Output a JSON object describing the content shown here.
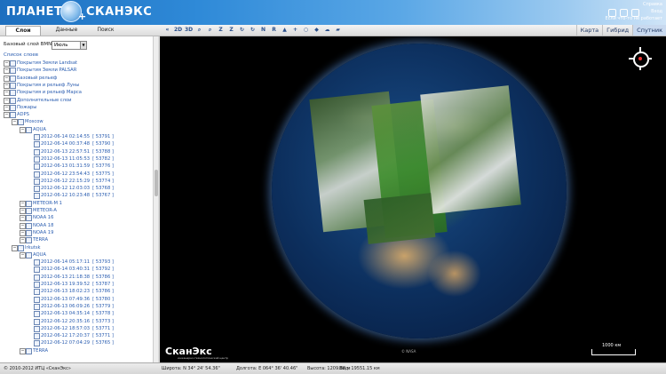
{
  "header": {
    "logo_left": "ПЛАНЕТА",
    "logo_right": "СКАНЭКС",
    "link1": "Справка",
    "link2": "Вход",
    "link3": "Если что-то не работает"
  },
  "tabs": {
    "layers": "Слои",
    "data": "Данные",
    "search": "Поиск"
  },
  "toolbar": {
    "tools": [
      "«",
      "2D",
      "3D",
      "⌕",
      "⌕",
      "Z",
      "Z",
      "↻",
      "↻",
      "N",
      "R",
      "▲",
      "+",
      "○",
      "◆",
      "☁",
      "▰"
    ],
    "map_tabs": [
      "Карта",
      "Гибрид",
      "Спутник"
    ],
    "active_map_tab": "Спутник"
  },
  "sidebar": {
    "base_label": "Базовый слой BMNG:",
    "base_value": "Июль",
    "list_header": "Список слоев",
    "rows": [
      {
        "d": 0,
        "t": "Покрытия Земли Landsat"
      },
      {
        "d": 0,
        "t": "Покрытия Земли PALSAR"
      },
      {
        "d": 0,
        "t": "Базовый рельеф"
      },
      {
        "d": 0,
        "t": "Покрытия и рельеф Луны"
      },
      {
        "d": 0,
        "t": "Покрытия и рельеф Марса"
      },
      {
        "d": 0,
        "t": "Дополнительные слои"
      },
      {
        "d": 0,
        "t": "Пожары"
      },
      {
        "d": 0,
        "t": "ADPS"
      },
      {
        "d": 1,
        "t": "Moscow"
      },
      {
        "d": 2,
        "t": "AQUA"
      },
      {
        "d": 3,
        "t": "2012-06-14 02:14:55",
        "id": "[ 53791 ]"
      },
      {
        "d": 3,
        "t": "2012-06-14 00:37:48",
        "id": "[ 53790 ]"
      },
      {
        "d": 3,
        "t": "2012-06-13 22:57:51",
        "id": "[ 53788 ]"
      },
      {
        "d": 3,
        "t": "2012-06-13 11:05:53",
        "id": "[ 53782 ]"
      },
      {
        "d": 3,
        "t": "2012-06-13 01:31:59",
        "id": "[ 53776 ]"
      },
      {
        "d": 3,
        "t": "2012-06-12 23:54:43",
        "id": "[ 53775 ]"
      },
      {
        "d": 3,
        "t": "2012-06-12 22:15:29",
        "id": "[ 53774 ]"
      },
      {
        "d": 3,
        "t": "2012-06-12 12:03:03",
        "id": "[ 53768 ]"
      },
      {
        "d": 3,
        "t": "2012-06-12 10:23:48",
        "id": "[ 53767 ]"
      },
      {
        "d": 2,
        "t": "METEOR-M 1"
      },
      {
        "d": 2,
        "t": "METEOR-A"
      },
      {
        "d": 2,
        "t": "NOAA 16"
      },
      {
        "d": 2,
        "t": "NOAA 18"
      },
      {
        "d": 2,
        "t": "NOAA 19"
      },
      {
        "d": 2,
        "t": "TERRA"
      },
      {
        "d": 1,
        "t": "Irkutsk"
      },
      {
        "d": 2,
        "t": "AQUA"
      },
      {
        "d": 3,
        "t": "2012-06-14 05:17:11",
        "id": "[ 53793 ]"
      },
      {
        "d": 3,
        "t": "2012-06-14 03:40:31",
        "id": "[ 53792 ]"
      },
      {
        "d": 3,
        "t": "2012-06-13 21:18:38",
        "id": "[ 53786 ]"
      },
      {
        "d": 3,
        "t": "2012-06-13 19:39:52",
        "id": "[ 53787 ]"
      },
      {
        "d": 3,
        "t": "2012-06-13 18:02:23",
        "id": "[ 53786 ]"
      },
      {
        "d": 3,
        "t": "2012-06-13 07:49:36",
        "id": "[ 53780 ]"
      },
      {
        "d": 3,
        "t": "2012-06-13 06:09:26",
        "id": "[ 53779 ]"
      },
      {
        "d": 3,
        "t": "2012-06-13 04:35:14",
        "id": "[ 53778 ]"
      },
      {
        "d": 3,
        "t": "2012-06-12 20:35:16",
        "id": "[ 53773 ]"
      },
      {
        "d": 3,
        "t": "2012-06-12 18:57:03",
        "id": "[ 53771 ]"
      },
      {
        "d": 3,
        "t": "2012-06-12 17:20:37",
        "id": "[ 53771 ]"
      },
      {
        "d": 3,
        "t": "2012-06-12 07:04:29",
        "id": "[ 53765 ]"
      },
      {
        "d": 2,
        "t": "TERRA"
      }
    ]
  },
  "map": {
    "brand": "СканЭкс",
    "brand_sub": "инженерно-технологический центр",
    "nasa": "© NASA",
    "scale": "1000 км"
  },
  "status": {
    "copyright": "© 2010-2012 ИТЦ «СканЭкс»",
    "lat": "Широта: N 34° 24' 54.36\"",
    "lon": "Долгота: E 064° 36' 40.46\"",
    "height": "Высота: 1209.88 м",
    "view": "Вид: 19551.15 км"
  }
}
